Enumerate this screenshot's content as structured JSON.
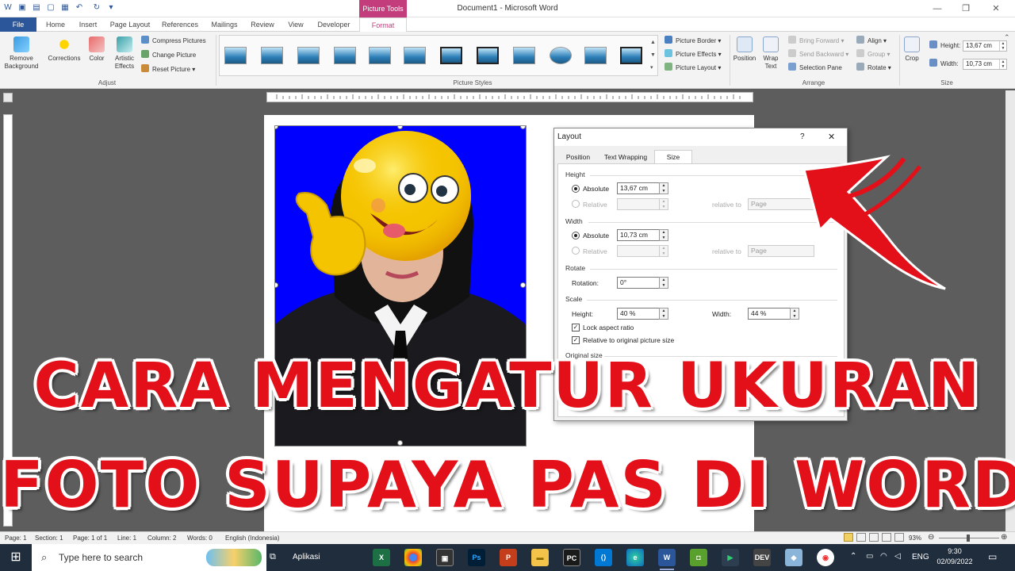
{
  "window": {
    "title": "Document1  -  Microsoft Word",
    "context_tab_group": "Picture Tools"
  },
  "tabs": [
    "File",
    "Home",
    "Insert",
    "Page Layout",
    "References",
    "Mailings",
    "Review",
    "View",
    "Developer",
    "Format"
  ],
  "ribbon": {
    "adjust": {
      "remove_background": "Remove Background",
      "corrections": "Corrections",
      "color": "Color",
      "artistic_effects": "Artistic Effects",
      "compress_pictures": "Compress Pictures",
      "change_picture": "Change Picture",
      "reset_picture": "Reset Picture",
      "label": "Adjust"
    },
    "picture_styles": {
      "picture_border": "Picture Border",
      "picture_effects": "Picture Effects",
      "picture_layout": "Picture Layout",
      "label": "Picture Styles"
    },
    "arrange": {
      "position": "Position",
      "wrap_text": "Wrap Text",
      "bring_forward": "Bring Forward",
      "send_backward": "Send Backward",
      "selection_pane": "Selection Pane",
      "align": "Align",
      "group": "Group",
      "rotate": "Rotate",
      "label": "Arrange"
    },
    "size": {
      "crop": "Crop",
      "height_label": "Height:",
      "height_value": "13,67 cm",
      "width_label": "Width:",
      "width_value": "10,73 cm",
      "label": "Size"
    }
  },
  "dialog": {
    "title": "Layout",
    "help": "?",
    "close": "✕",
    "tabs": [
      "Position",
      "Text Wrapping",
      "Size"
    ],
    "height": {
      "section": "Height",
      "absolute_label": "Absolute",
      "absolute_value": "13,67 cm",
      "relative_label": "Relative",
      "relative_to_label": "relative to",
      "relative_to_value": "Page"
    },
    "width": {
      "section": "Width",
      "absolute_label": "Absolute",
      "absolute_value": "10,73 cm",
      "relative_label": "Relative",
      "relative_to_label": "relative to",
      "relative_to_value": "Page"
    },
    "rotate": {
      "section": "Rotate",
      "rotation_label": "Rotation:",
      "rotation_value": "0°"
    },
    "scale": {
      "section": "Scale",
      "height_label": "Height:",
      "height_value": "40 %",
      "width_label": "Width:",
      "width_value": "44 %",
      "lock_aspect_ratio": "Lock aspect ratio",
      "relative_to_original": "Relative to original picture size"
    },
    "original_size": {
      "section": "Original size"
    }
  },
  "overlay": {
    "line1": "CARA MENGATUR UKURAN",
    "line2": "FOTO SUPAYA PAS DI WORD"
  },
  "statusbar": {
    "page": "Page: 1",
    "section": "Section: 1",
    "page_of": "Page: 1 of 1",
    "line": "Line: 1",
    "column": "Column: 2",
    "words": "Words: 0",
    "language": "English (Indonesia)",
    "zoom": "93%"
  },
  "taskbar": {
    "search_placeholder": "Type here to search",
    "aplikasi": "Aplikasi",
    "lang": "ENG",
    "time": "9:30",
    "date": "02/09/2022"
  },
  "colors": {
    "word_blue": "#2b579a",
    "picture_tools": "#c33c7b",
    "headline_red": "#e3101a",
    "photo_bg": "#0000ff"
  }
}
